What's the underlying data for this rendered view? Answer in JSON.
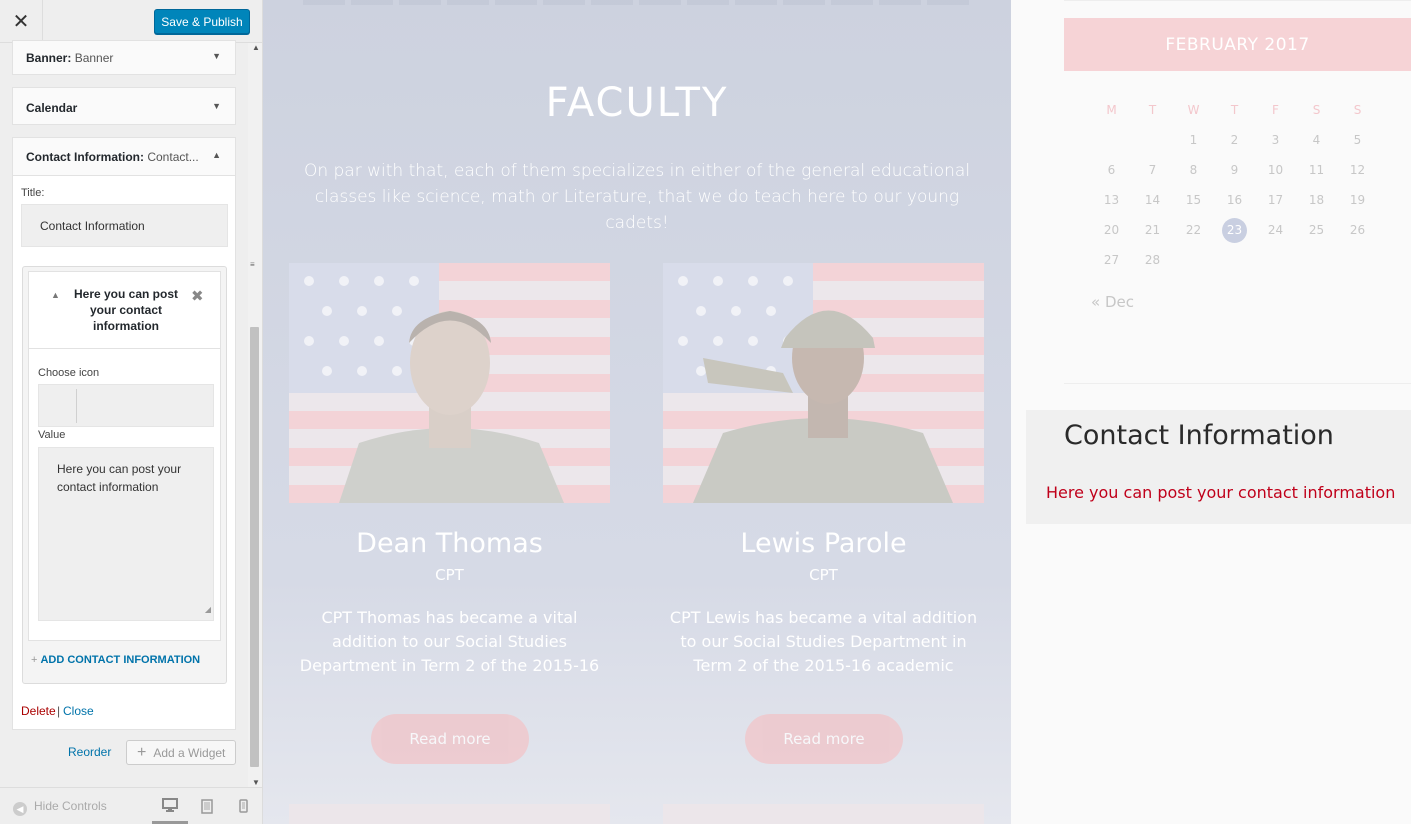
{
  "sidebar": {
    "close_icon": "close-icon",
    "publish_label": "Save & Publish",
    "widgets": {
      "banner": {
        "title": "Banner",
        "subtitle": "Banner"
      },
      "calendar": {
        "title": "Calendar"
      },
      "contact": {
        "title": "Contact Information:",
        "subtitle": "Contact..."
      }
    },
    "contact_form": {
      "title_label": "Title:",
      "title_value": "Contact Information",
      "item_title": "Here you can post your contact information",
      "icon_label": "Choose icon",
      "value_label": "Value",
      "value_text": "Here you can post your contact information",
      "add_label": "ADD CONTACT INFORMATION",
      "delete_label": "Delete",
      "separator": "|",
      "close_label": "Close"
    },
    "reorder_label": "Reorder",
    "add_widget_label": "Add a Widget",
    "hide_controls_label": "Hide Controls",
    "devices": [
      "desktop-icon",
      "tablet-icon",
      "mobile-icon"
    ]
  },
  "preview": {
    "section_title": "FACULTY",
    "section_desc": "On par with that, each of them specializes in either of the general educational classes like science, math or Literature, that we do teach here to our young cadets!",
    "people": [
      {
        "name": "Dean Thomas",
        "rank": "CPT",
        "bio": "CPT Thomas has became a vital addition to our Social Studies Department in Term 2 of the 2015-16",
        "button": "Read more"
      },
      {
        "name": "Lewis Parole",
        "rank": "CPT",
        "bio": "CPT Lewis has became a vital addition to our Social Studies Department in Term 2 of the 2015-16 academic",
        "button": "Read more"
      }
    ],
    "calendar": {
      "month": "FEBRUARY 2017",
      "weekdays": [
        "M",
        "T",
        "W",
        "T",
        "F",
        "S",
        "S"
      ],
      "weeks": [
        [
          "",
          "",
          "1",
          "2",
          "3",
          "4",
          "5"
        ],
        [
          "6",
          "7",
          "8",
          "9",
          "10",
          "11",
          "12"
        ],
        [
          "13",
          "14",
          "15",
          "16",
          "17",
          "18",
          "19"
        ],
        [
          "20",
          "21",
          "22",
          "23",
          "24",
          "25",
          "26"
        ],
        [
          "27",
          "28",
          "",
          "",
          "",
          "",
          ""
        ]
      ],
      "today": "23",
      "prev_link": "« Dec"
    },
    "contact_widget": {
      "heading": "Contact Information",
      "text": "Here you can post your contact information"
    }
  },
  "colors": {
    "publish": "#0085ba",
    "link": "#0073aa",
    "delete": "#aa0000",
    "calendar_header": "#f6d3d6",
    "contact_text": "#c0001a"
  }
}
